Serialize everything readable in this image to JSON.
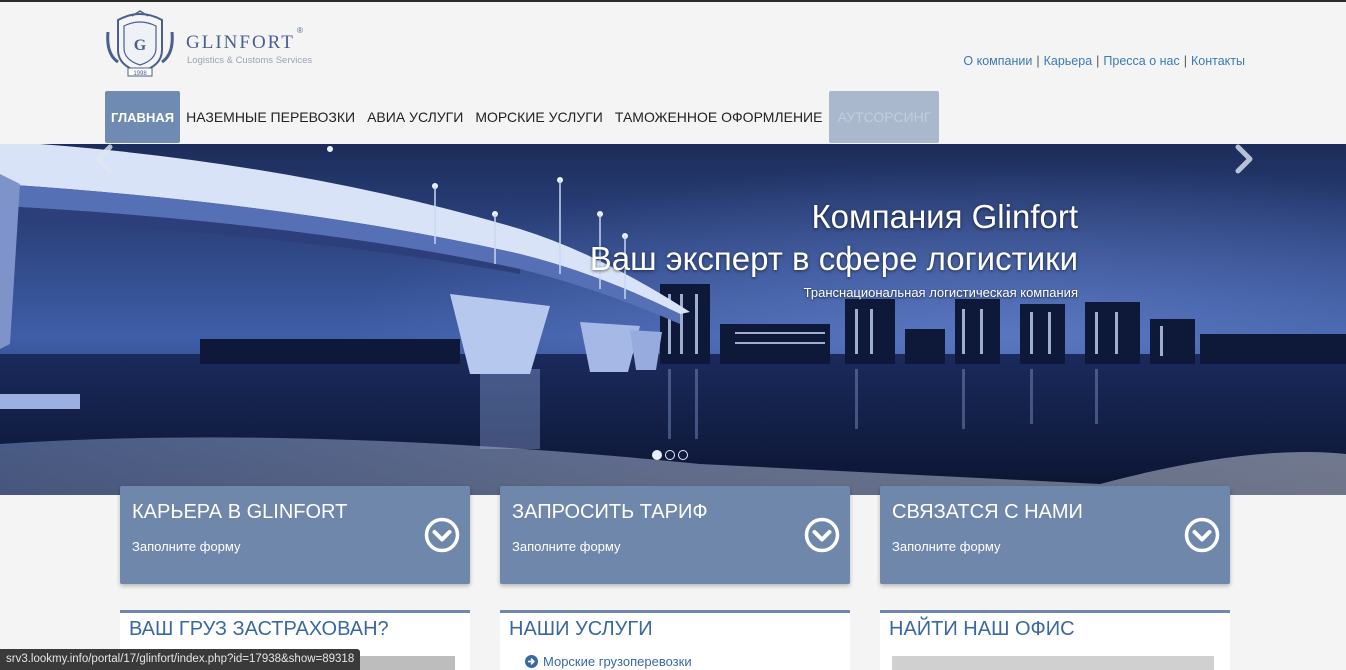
{
  "logo": {
    "name": "GLINFORT",
    "registered": "®",
    "subtitle": "Logistics & Customs Services",
    "year": "1998",
    "emblem_letter": "G"
  },
  "toplinks": [
    {
      "label": "О компании"
    },
    {
      "label": "Карьера"
    },
    {
      "label": "Пресса о нас"
    },
    {
      "label": "Контакты"
    }
  ],
  "nav": [
    {
      "label": "Главная",
      "active": true
    },
    {
      "label": "Наземные перевозки"
    },
    {
      "label": "Авиа услуги"
    },
    {
      "label": "Морские услуги"
    },
    {
      "label": "Таможенное оформление"
    },
    {
      "label": "Аутсорсинг"
    }
  ],
  "hero": {
    "title_line1": "Компания Glinfort",
    "title_line2": "Ваш эксперт в сфере логистики",
    "subtitle": "Транснациональная логистическая компания",
    "active_slide": 1,
    "slide_count": 3
  },
  "cta": [
    {
      "title": "Карьера в GLINFORT",
      "subtitle": "Заполните форму"
    },
    {
      "title": "Запросить тариф",
      "subtitle": "Заполните форму"
    },
    {
      "title": "Связатся с нами",
      "subtitle": "Заполните форму"
    }
  ],
  "panels": [
    {
      "title": "Ваш груз застрахован?"
    },
    {
      "title": "Наши услуги",
      "link": "Морские грузоперевозки"
    },
    {
      "title": "Найти наш офис"
    }
  ],
  "statusbar": "srv3.lookmy.info/portal/17/glinfort/index.php?id=17938&show=89318",
  "colors": {
    "accent": "#6f87ab",
    "nav_active": "#6f8bb2",
    "link": "#3a7ab5",
    "panel_title": "#3a68a3"
  }
}
